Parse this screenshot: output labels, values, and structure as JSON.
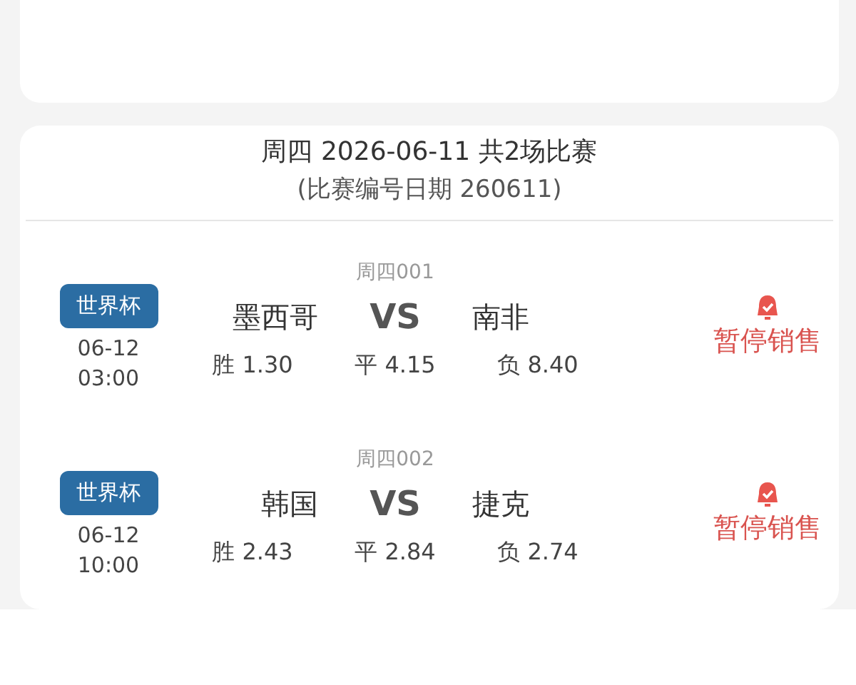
{
  "day_header": {
    "title": "周四 2026-06-11 共2场比赛",
    "subtitle": "(比赛编号日期 260611)"
  },
  "matches": [
    {
      "code": "周四001",
      "league": "世界杯",
      "date": "06-12",
      "time": "03:00",
      "home": "墨西哥",
      "vs": "VS",
      "away": "南非",
      "odds": [
        "胜 1.30",
        "平 4.15",
        "负 8.40"
      ],
      "status": "暂停销售"
    },
    {
      "code": "周四002",
      "league": "世界杯",
      "date": "06-12",
      "time": "10:00",
      "home": "韩国",
      "vs": "VS",
      "away": "捷克",
      "odds": [
        "胜 2.43",
        "平 2.84",
        "负 2.74"
      ],
      "status": "暂停销售"
    }
  ]
}
